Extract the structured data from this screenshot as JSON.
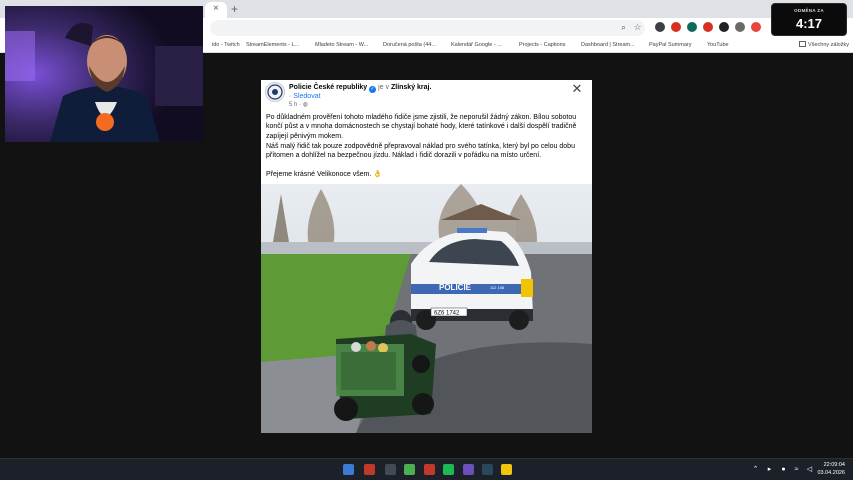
{
  "browser": {
    "new_tab_label": "+",
    "tab_close_label": "×",
    "bookmarks": [
      {
        "label": "ido - Twitch",
        "color": "#9146ff"
      },
      {
        "label": "StreamElements - L...",
        "color": "#222222"
      },
      {
        "label": "Mladeto Stream - W...",
        "color": "#888888"
      },
      {
        "label": "Doručená pošta (44...",
        "color": "#d93025"
      },
      {
        "label": "Kalendář Google - ...",
        "color": "#1a73e8"
      },
      {
        "label": "Projects - Captions",
        "color": "#111111"
      },
      {
        "label": "Dashboard | Stream...",
        "color": "#5b3cc4"
      },
      {
        "label": "PayPal Summary",
        "color": "#003087"
      },
      {
        "label": "YouTube",
        "color": "#ff0000"
      }
    ],
    "all_bookmarks_label": "Všechny záložky"
  },
  "timer": {
    "label": "ODMĚNA ZA",
    "value": "4:17"
  },
  "post": {
    "page_name": "Policie České republiky",
    "is_in_text": "je v",
    "location": "Zlínský kraj.",
    "follow_prefix": "·",
    "follow_label": "Sledovat",
    "time_ago": "5 h ·",
    "paragraphs": [
      "Po důkladném prověření tohoto mladého řidiče jsme zjistili, že neporušil žádný zákon. Bílou sobotou končí půst a v mnoha domácnostech se chystají bohaté hody, které tatínkové i další dospělí tradičně zapíjejí pěnivým mokem.",
      "Náš malý řidič tak pouze zodpovědně přepravoval náklad pro svého tatínka, který byl po celou dobu přítomen a dohlížel na bezpečnou jízdu. Náklad i řidič dorazili v pořádku na místo určení.",
      "Přejeme krásné Velikonoce všem. 👌"
    ],
    "photo": {
      "car_text": "POLICIE",
      "plate": "6Z6 1742",
      "badge_text": "112 158"
    }
  },
  "taskbar": {
    "clock_time": "22:09:04",
    "clock_date": "03.04.2026"
  },
  "colors": {
    "page_bg": "#121212",
    "post_bg": "#ffffff",
    "link_blue": "#1877f2",
    "taskbar_bg": "#1c2028"
  }
}
